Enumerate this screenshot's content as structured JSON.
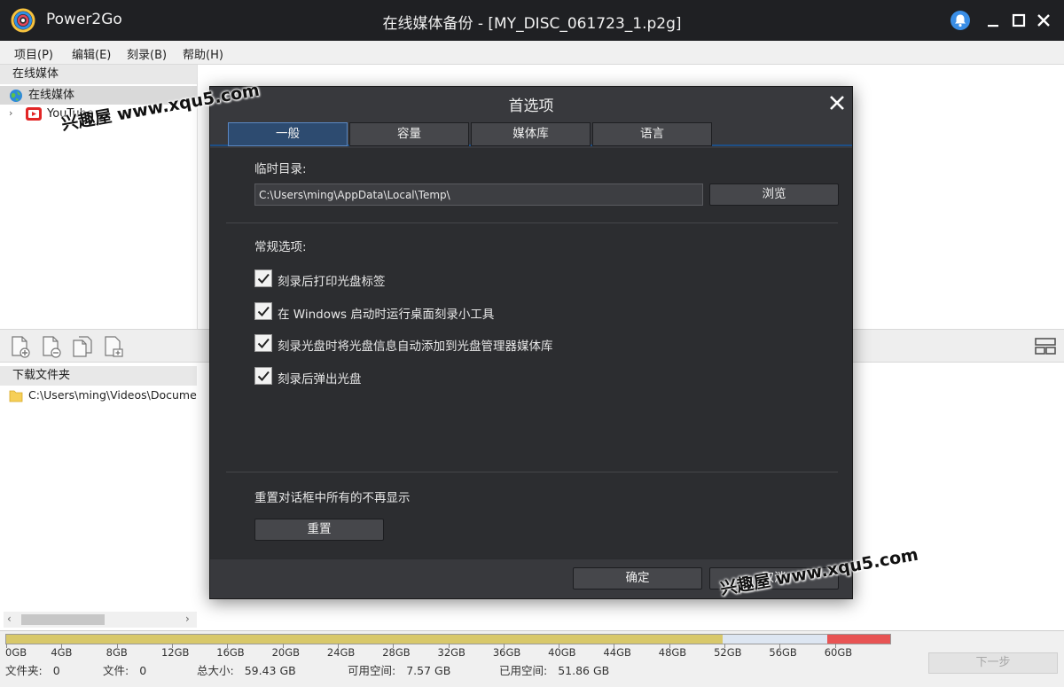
{
  "app": {
    "name": "Power2Go",
    "window_title": "在线媒体备份 - [MY_DISC_061723_1.p2g]"
  },
  "menu": [
    "项目(P)",
    "编辑(E)",
    "刻录(B)",
    "帮助(H)"
  ],
  "online_media": {
    "header": "在线媒体",
    "root_label": "在线媒体",
    "child_label": "YouTube"
  },
  "download": {
    "header": "下载文件夹",
    "folder_path": "C:\\Users\\ming\\Videos\\Documents"
  },
  "capacity": {
    "ticks": [
      "0GB",
      "4GB",
      "8GB",
      "12GB",
      "16GB",
      "20GB",
      "24GB",
      "28GB",
      "32GB",
      "36GB",
      "40GB",
      "44GB",
      "48GB",
      "52GB",
      "56GB",
      "60GB"
    ],
    "max_gb": 64,
    "used_gb": 51.86,
    "available_gb": 7.57,
    "total_gb": 59.43,
    "colors": {
      "used": "#d8c86a",
      "free": "#dde6f2",
      "over": "#e85454"
    }
  },
  "status": {
    "folders_label": "文件夹:",
    "folders_value": "0",
    "files_label": "文件:",
    "files_value": "0",
    "total_label": "总大小:",
    "total_value": "59.43 GB",
    "available_label": "可用空间:",
    "available_value": "7.57 GB",
    "used_label": "已用空间:",
    "used_value": "51.86 GB"
  },
  "next_button": "下一步",
  "dialog": {
    "title": "首选项",
    "tabs": [
      "一般",
      "容量",
      "媒体库",
      "语言"
    ],
    "active_tab": 0,
    "temp_dir_label": "临时目录:",
    "temp_dir_value": "C:\\Users\\ming\\AppData\\Local\\Temp\\",
    "browse_label": "浏览",
    "general_options_label": "常规选项:",
    "options": [
      {
        "label": "刻录后打印光盘标签",
        "checked": true
      },
      {
        "label": "在 Windows 启动时运行桌面刻录小工具",
        "checked": true
      },
      {
        "label": "刻录光盘时将光盘信息自动添加到光盘管理器媒体库",
        "checked": true
      },
      {
        "label": "刻录后弹出光盘",
        "checked": true
      }
    ],
    "reset_text": "重置对话框中所有的不再显示",
    "reset_label": "重置",
    "ok_label": "确定",
    "cancel_label": "取消"
  },
  "watermarks": [
    "兴趣屋 www.xqu5.com",
    "兴趣屋 www.xqu5.com"
  ],
  "icons": {
    "app_logo": "power2go-logo-icon",
    "notification": "bell-icon",
    "minimize": "minimize-icon",
    "maximize": "maximize-icon",
    "close": "close-icon"
  }
}
